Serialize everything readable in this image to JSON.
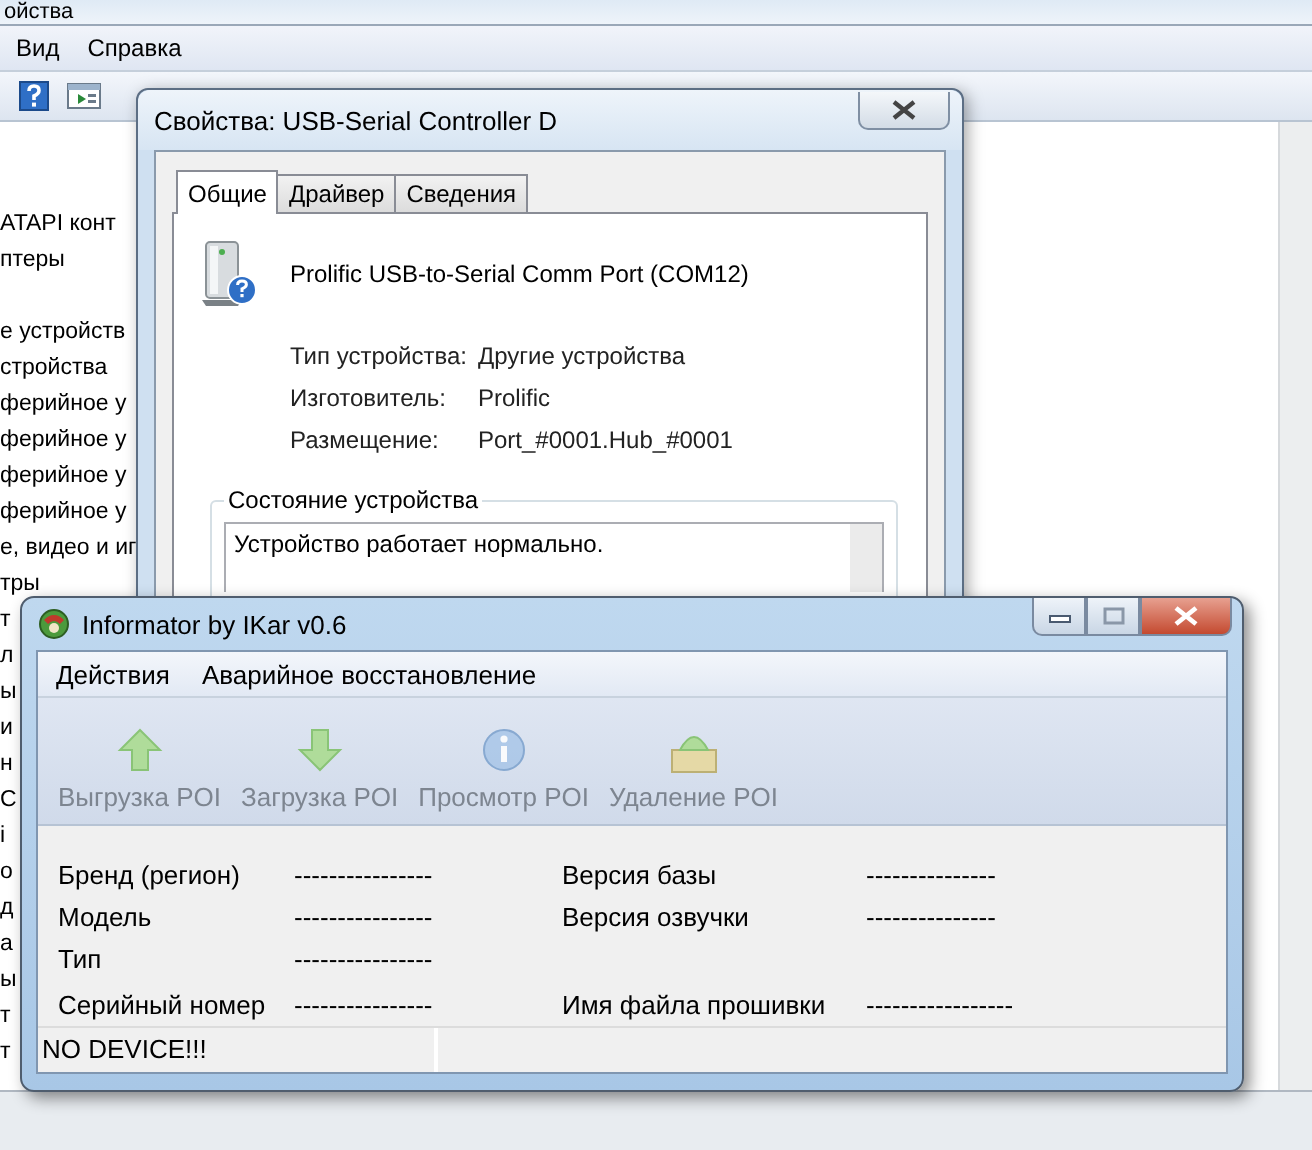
{
  "background_window": {
    "title": "ойства",
    "menu": [
      "Вид",
      "Справка"
    ],
    "tree_items": [
      "ATAPI конт",
      "птеры",
      "е устройств",
      "стройства",
      "ферийное у",
      "ферийное у",
      "ферийное у",
      "ферийное у",
      "е, видео и иг",
      "тры",
      "т",
      "л",
      "ы",
      "и",
      "н",
      "C",
      "i",
      "о",
      "д",
      "а",
      "ы",
      "т",
      "т"
    ]
  },
  "properties_dialog": {
    "title": "Свойства: USB-Serial Controller D",
    "tabs": [
      {
        "label": "Общие",
        "selected": true
      },
      {
        "label": "Драйвер",
        "selected": false
      },
      {
        "label": "Сведения",
        "selected": false
      }
    ],
    "device_name": "Prolific USB-to-Serial Comm Port (COM12)",
    "fields": [
      {
        "label": "Тип устройства:",
        "value": "Другие устройства"
      },
      {
        "label": "Изготовитель:",
        "value": "Prolific"
      },
      {
        "label": "Размещение:",
        "value": "Port_#0001.Hub_#0001"
      }
    ],
    "status_group": {
      "title": "Состояние устройства",
      "text": "Устройство работает нормально."
    }
  },
  "informator": {
    "title": "Informator by IKar v0.6",
    "menu": [
      "Действия",
      "Аварийное восстановление"
    ],
    "toolbar": [
      {
        "label": "Выгрузка POI",
        "kind": "upload",
        "disabled": true
      },
      {
        "label": "Загрузка POI",
        "kind": "download",
        "disabled": true
      },
      {
        "label": "Просмотр POI",
        "kind": "view",
        "disabled": true
      },
      {
        "label": "Удаление POI",
        "kind": "delete",
        "disabled": true
      }
    ],
    "left_fields": [
      {
        "label": "Бренд (регион)",
        "value": "----------------"
      },
      {
        "label": "Модель",
        "value": "----------------"
      },
      {
        "label": "Тип",
        "value": "----------------"
      },
      {
        "label": "Серийный номер",
        "value": "----------------"
      }
    ],
    "right_fields": [
      {
        "label": "Версия базы",
        "value": "---------------"
      },
      {
        "label": "Версия озвучки",
        "value": "---------------"
      },
      {
        "label": "Имя файла прошивки",
        "value": "-----------------"
      }
    ],
    "status_bar": [
      "NO DEVICE!!!"
    ]
  }
}
